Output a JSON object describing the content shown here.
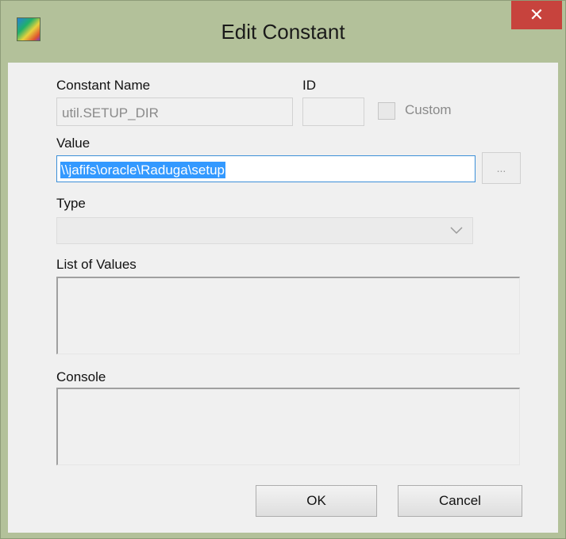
{
  "window": {
    "title": "Edit Constant",
    "close_label": "✕"
  },
  "form": {
    "constant_name_label": "Constant Name",
    "constant_name_value": "util.SETUP_DIR",
    "id_label": "ID",
    "id_value": "",
    "custom_label": "Custom",
    "custom_checked": false,
    "value_label": "Value",
    "value_text": "\\\\jafifs\\oracle\\Raduga\\setup",
    "browse_label": "...",
    "type_label": "Type",
    "type_value": "",
    "list_of_values_label": "List of Values",
    "console_label": "Console"
  },
  "buttons": {
    "ok_label": "OK",
    "cancel_label": "Cancel"
  },
  "colors": {
    "selection": "#3399ff",
    "close_button": "#c7433d",
    "title_bar": "#b3c19a"
  }
}
